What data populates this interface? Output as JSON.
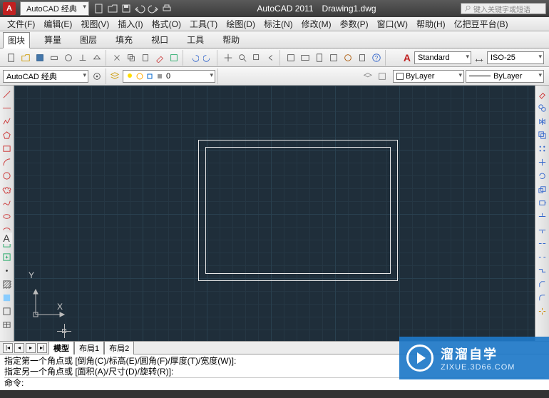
{
  "title": {
    "workspace": "AutoCAD 经典",
    "app": "AutoCAD 2011",
    "file": "Drawing1.dwg",
    "search_placeholder": "键入关键字或短语"
  },
  "menubar": [
    "文件(F)",
    "编辑(E)",
    "视图(V)",
    "插入(I)",
    "格式(O)",
    "工具(T)",
    "绘图(D)",
    "标注(N)",
    "修改(M)",
    "参数(P)",
    "窗口(W)",
    "帮助(H)",
    "亿把豆平台(B)"
  ],
  "tabrow": [
    "图块",
    "算量",
    "图层",
    "填充",
    "视口",
    "工具",
    "帮助"
  ],
  "active_tab": "图块",
  "props": {
    "workspace_dd": "AutoCAD 经典",
    "layer_dd": "0",
    "color_dd": "ByLayer",
    "linetype_dd": "ByLayer",
    "textstyle": "Standard",
    "dimstyle": "ISO-25"
  },
  "model_tabs": {
    "nav": [
      "|◂",
      "◂",
      "▸",
      "▸|"
    ],
    "tabs": [
      "模型",
      "布局1",
      "布局2"
    ],
    "active": "模型"
  },
  "command": {
    "line1": "指定第一个角点或 [倒角(C)/标高(E)/圆角(F)/厚度(T)/宽度(W)]:",
    "line2": "指定另一个角点或 [面积(A)/尺寸(D)/旋转(R)]:",
    "prompt": "命令:"
  },
  "ucs": {
    "x": "X",
    "y": "Y"
  },
  "watermark": {
    "t1": "溜溜自学",
    "t2": "ZIXUE.3D66.COM"
  },
  "icons": {
    "new": "new",
    "open": "open",
    "save": "save",
    "undo": "undo",
    "redo": "redo",
    "print": "print",
    "plot": "plot",
    "cut": "cut",
    "copy": "copy",
    "paste": "paste",
    "match": "match",
    "pan": "pan",
    "zoom": "zoom"
  }
}
